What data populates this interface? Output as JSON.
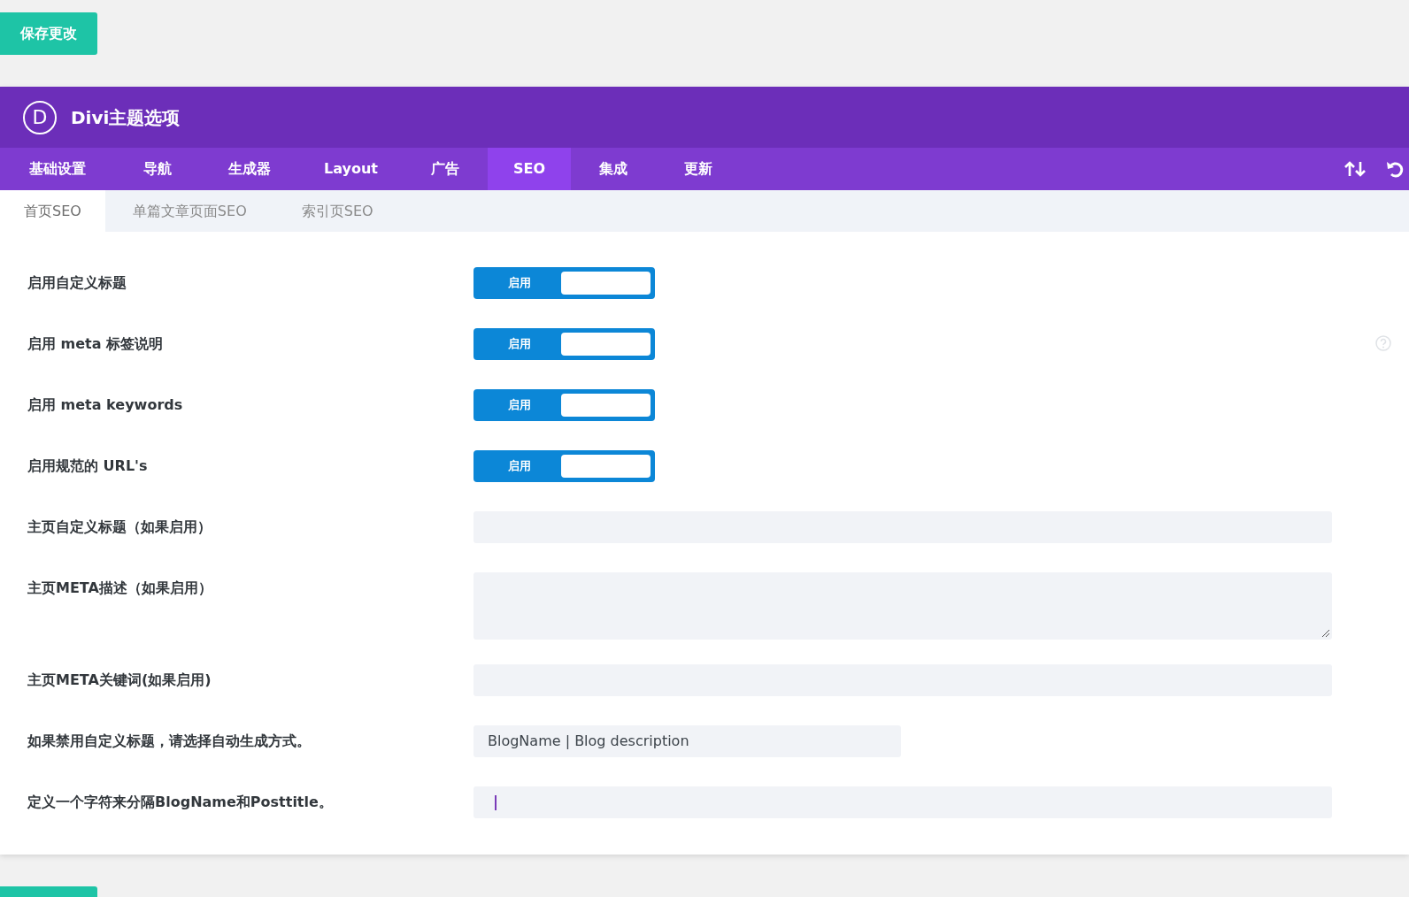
{
  "save_button": "保存更改",
  "header": {
    "logo_letter": "D",
    "title": "Divi主题选项"
  },
  "tabs": [
    {
      "label": "基础设置",
      "selected": false
    },
    {
      "label": "导航",
      "selected": false
    },
    {
      "label": "生成器",
      "selected": false
    },
    {
      "label": "Layout",
      "selected": false
    },
    {
      "label": "广告",
      "selected": false
    },
    {
      "label": "SEO",
      "selected": true
    },
    {
      "label": "集成",
      "selected": false
    },
    {
      "label": "更新",
      "selected": false
    }
  ],
  "subtabs": [
    {
      "label": "首页SEO",
      "selected": true
    },
    {
      "label": "单篇文章页面SEO",
      "selected": false
    },
    {
      "label": "索引页SEO",
      "selected": false
    }
  ],
  "options": [
    {
      "kind": "toggle",
      "label": "启用自定义标题",
      "toggle_label": "启用",
      "on": true
    },
    {
      "kind": "toggle",
      "label": "启用 meta 标签说明",
      "toggle_label": "启用",
      "on": true,
      "help": true
    },
    {
      "kind": "toggle",
      "label": "启用 meta keywords",
      "toggle_label": "启用",
      "on": true
    },
    {
      "kind": "toggle",
      "label": "启用规范的 URL's",
      "toggle_label": "启用",
      "on": true
    },
    {
      "kind": "text",
      "label": "主页自定义标题（如果启用）"
    },
    {
      "kind": "textarea",
      "label": "主页META描述（如果启用）"
    },
    {
      "kind": "text",
      "label": "主页META关键词(如果启用)"
    },
    {
      "kind": "select",
      "label": "如果禁用自定义标题，请选择自动生成方式。",
      "value": "BlogName | Blog description"
    },
    {
      "kind": "text",
      "label": "定义一个字符来分隔BlogName和Posttitle。",
      "focused": true
    }
  ]
}
